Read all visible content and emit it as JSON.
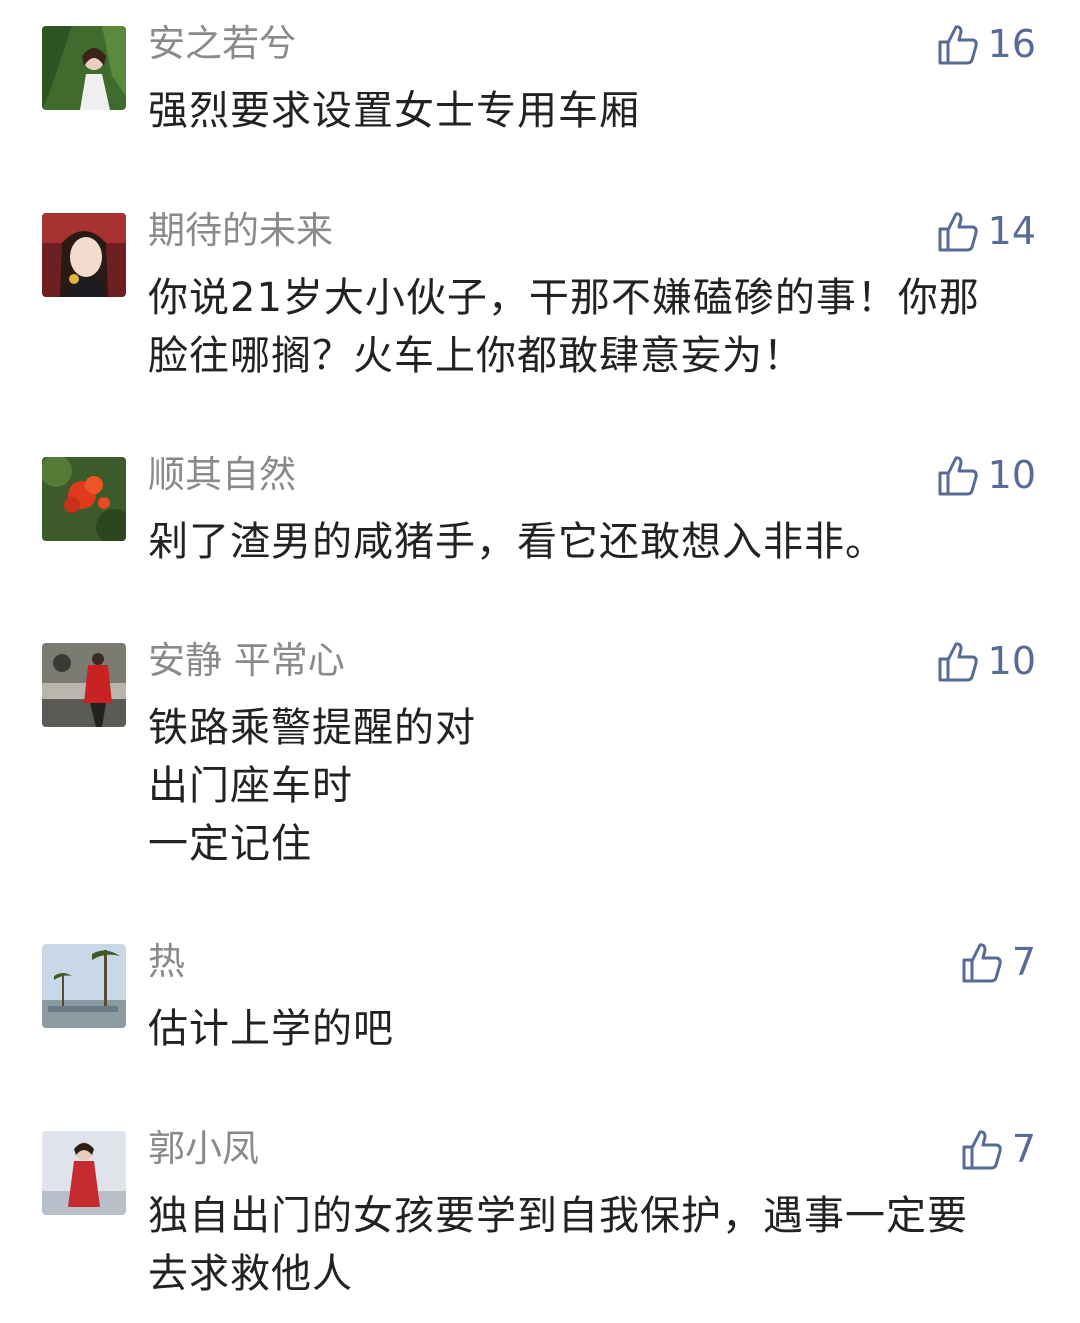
{
  "colors": {
    "name": "#8a8a8a",
    "like": "#576b95",
    "text": "#222222"
  },
  "comments": [
    {
      "name": "安之若兮",
      "likes": "16",
      "lines": [
        "强烈要求设置女士专用车厢"
      ]
    },
    {
      "name": "期待的未来",
      "likes": "14",
      "lines": [
        "你说21岁大小伙子，干那不嫌磕碜的事！你那",
        "脸往哪搁？火车上你都敢肆意妄为！"
      ]
    },
    {
      "name": "顺其自然",
      "likes": "10",
      "lines": [
        "剁了渣男的咸猪手，看它还敢想入非非。"
      ]
    },
    {
      "name": "安静 平常心",
      "likes": "10",
      "lines": [
        "铁路乘警提醒的对",
        "出门座车时",
        "一定记住"
      ]
    },
    {
      "name": "热",
      "likes": "7",
      "lines": [
        "估计上学的吧"
      ]
    },
    {
      "name": "郭小凤",
      "likes": "7",
      "lines": [
        "独自出门的女孩要学到自我保护，遇事一定要",
        "去求救他人"
      ]
    }
  ],
  "icons": {
    "like": "thumbs-up-icon"
  }
}
